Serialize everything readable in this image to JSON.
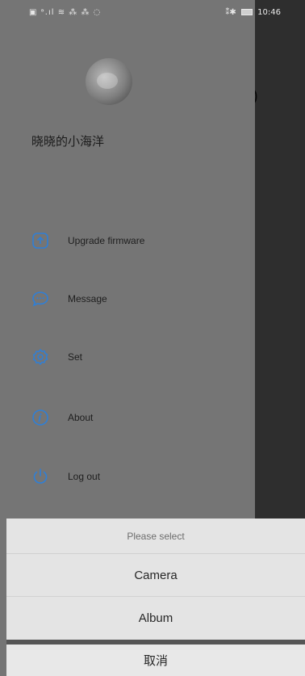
{
  "status_bar": {
    "left": "▣ ᵊ.ıl ≋ ⁂ ⁂ ◌",
    "right_icons": "⁑✱",
    "time": "10:46"
  },
  "profile": {
    "username": "晓晓的小海洋"
  },
  "menu": {
    "items": [
      {
        "label": "Upgrade firmware",
        "icon": "upgrade-icon"
      },
      {
        "label": "Message",
        "icon": "message-icon"
      },
      {
        "label": "Set",
        "icon": "gear-icon"
      },
      {
        "label": "About",
        "icon": "info-icon"
      },
      {
        "label": "Log out",
        "icon": "power-icon"
      }
    ]
  },
  "action_sheet": {
    "title": "Please select",
    "options": [
      "Camera",
      "Album"
    ],
    "cancel": "取消"
  },
  "colors": {
    "accent": "#2f7fd6"
  }
}
